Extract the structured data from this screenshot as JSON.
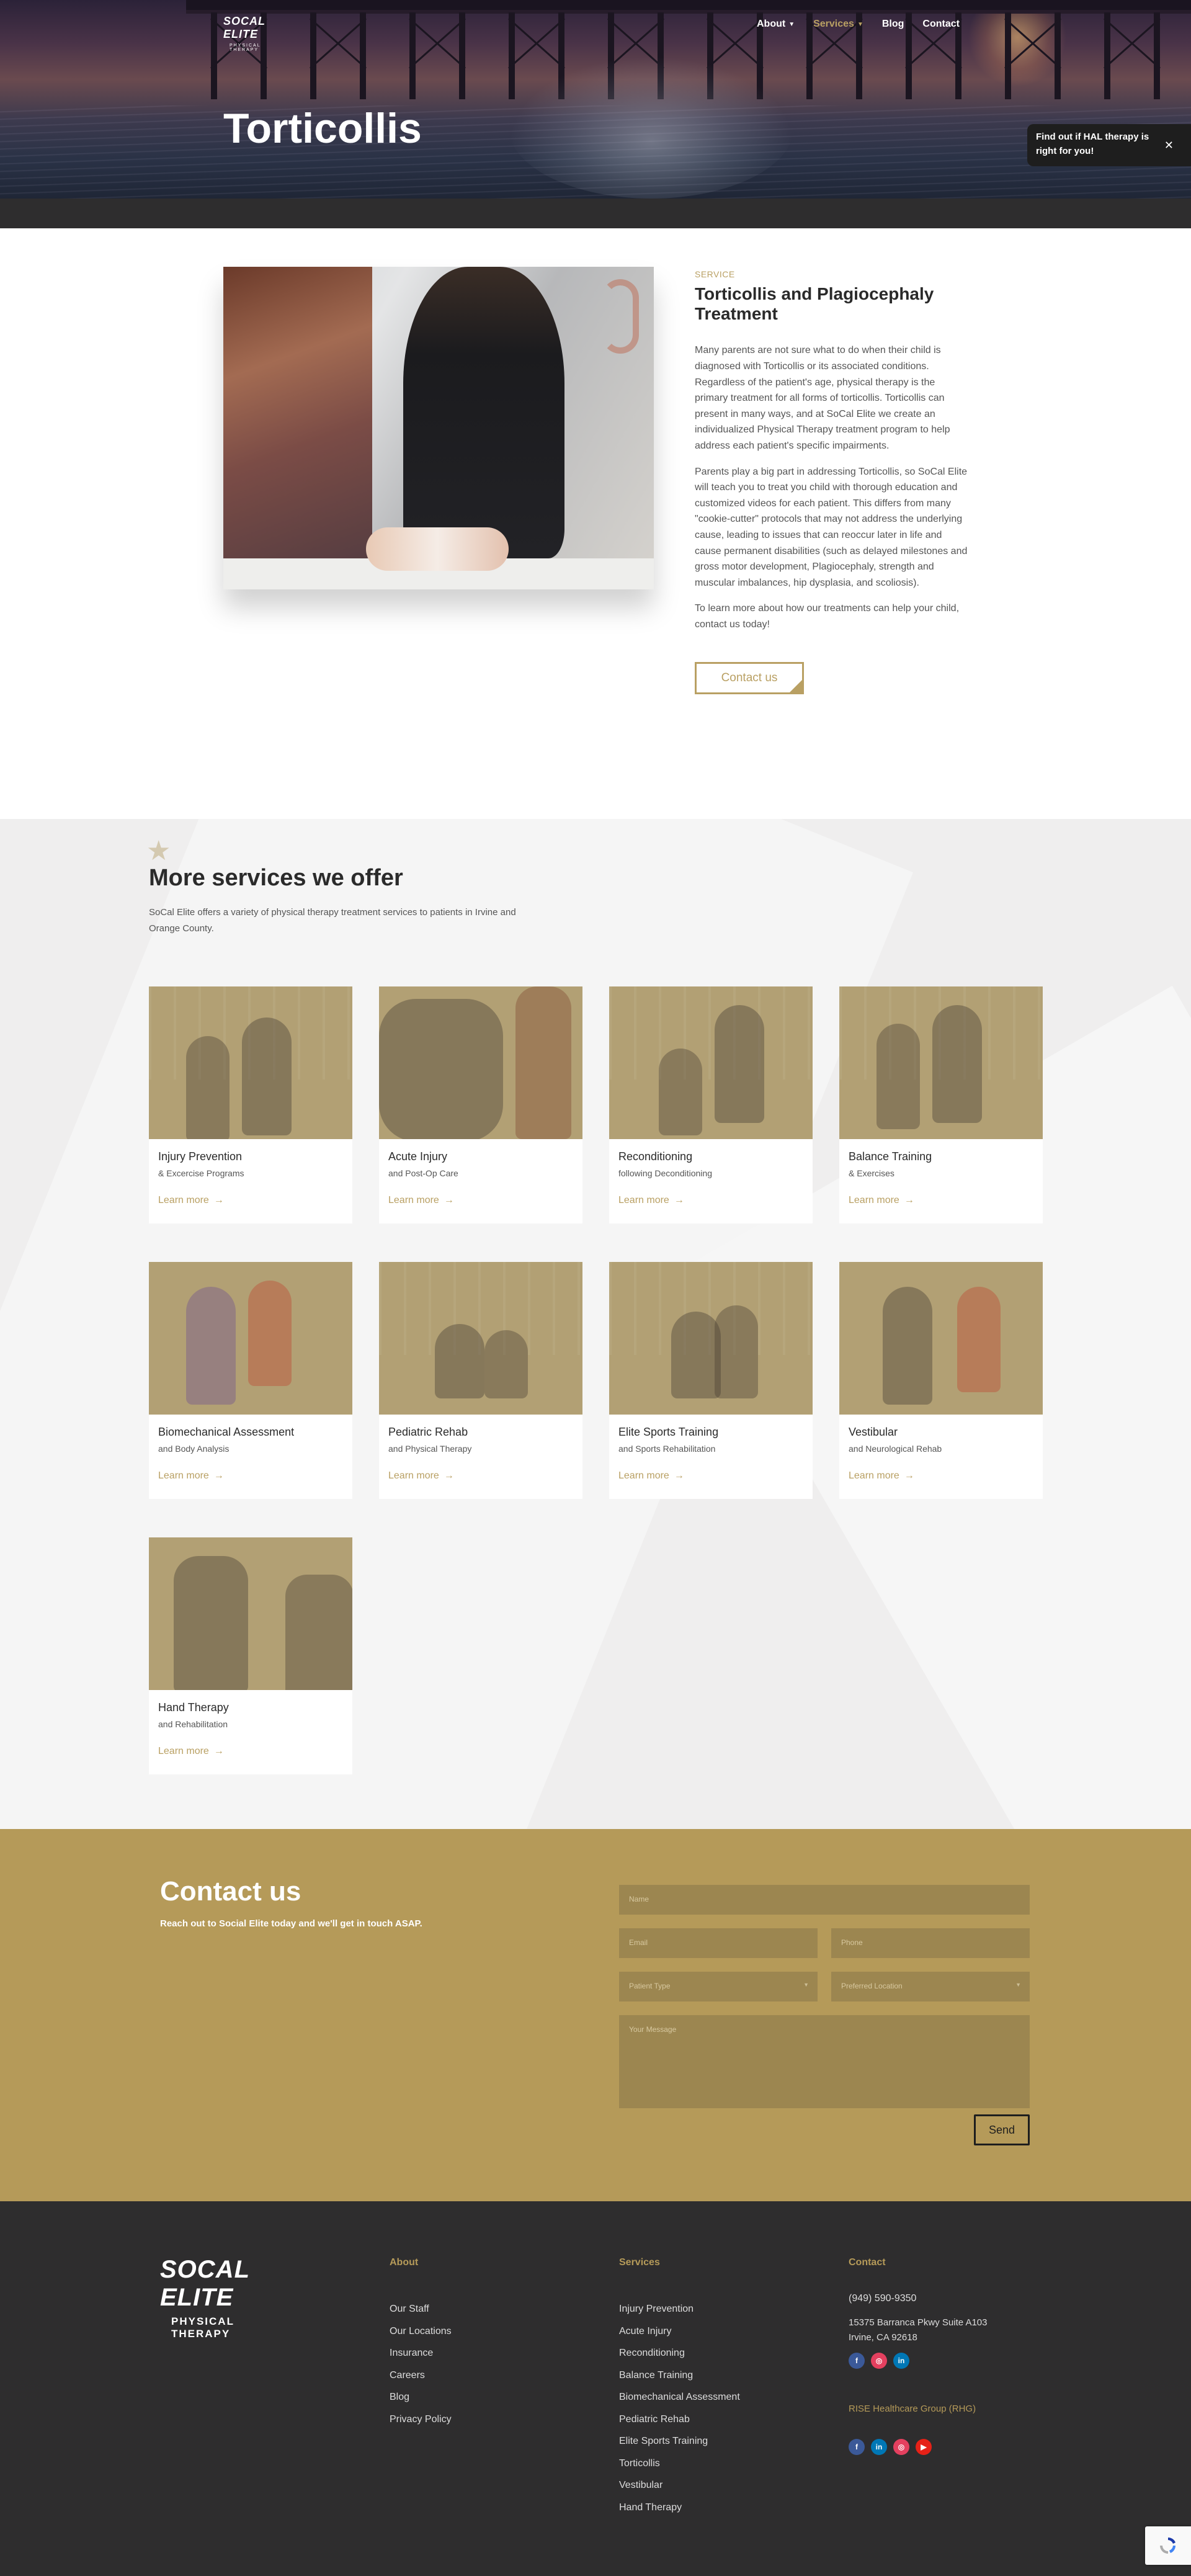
{
  "header": {
    "logo_line1": "SOCAL ELITE",
    "logo_line2": "PHYSICAL THERAPY",
    "nav": [
      {
        "label": "About",
        "chevron": true,
        "active": false
      },
      {
        "label": "Services",
        "chevron": true,
        "active": true
      },
      {
        "label": "Blog",
        "chevron": false,
        "active": false
      },
      {
        "label": "Contact",
        "chevron": false,
        "active": false
      }
    ],
    "title": "Torticollis",
    "hal_popup": "Find out if HAL therapy is right for you!",
    "hal_close_icon": "close-icon"
  },
  "service": {
    "label": "SERVICE",
    "title": "Torticollis and Plagiocephaly Treatment",
    "paragraphs": [
      "Many parents are not sure what to do when their child is diagnosed with Torticollis or its associated conditions. Regardless of the patient's age, physical therapy is the primary treatment for all forms of torticollis. Torticollis can present in many ways, and at SoCal Elite we create an individualized Physical Therapy treatment program to help address each patient's specific impairments.",
      "Parents play a big part in addressing Torticollis, so SoCal Elite will teach you to treat you child with thorough education and customized videos for each patient. This differs from many \"cookie-cutter\" protocols that may not address the underlying cause, leading to issues that can reoccur later in life and cause permanent disabilities (such as delayed milestones and gross motor development, Plagiocephaly, strength and muscular imbalances, hip dysplasia, and scoliosis).",
      "To learn more about how our treatments can help your child, contact us today!"
    ],
    "button": "Contact us"
  },
  "more_services": {
    "title": "More services we offer",
    "intro": "SoCal Elite offers a variety of physical therapy treatment services to patients in Irvine and Orange County.",
    "learn_more": "Learn more",
    "cards": [
      {
        "title": "Injury Prevention",
        "subtitle": "& Excercise Programs"
      },
      {
        "title": "Acute Injury",
        "subtitle": "and Post-Op Care"
      },
      {
        "title": "Reconditioning",
        "subtitle": "following Deconditioning"
      },
      {
        "title": "Balance Training",
        "subtitle": "& Exercises"
      },
      {
        "title": "Biomechanical Assessment",
        "subtitle": "and Body Analysis"
      },
      {
        "title": "Pediatric Rehab",
        "subtitle": "and Physical Therapy"
      },
      {
        "title": "Elite Sports Training",
        "subtitle": "and Sports Rehabilitation"
      },
      {
        "title": "Vestibular",
        "subtitle": "and Neurological Rehab"
      },
      {
        "title": "Hand Therapy",
        "subtitle": "and Rehabilitation"
      }
    ]
  },
  "contact": {
    "title": "Contact us",
    "subtitle": "Reach out to Social Elite today and we'll get in touch ASAP.",
    "fields": {
      "name": "Name",
      "email": "Email",
      "phone": "Phone",
      "patient_type": "Patient Type",
      "location": "Preferred Location",
      "message": "Your Message"
    },
    "send": "Send"
  },
  "footer": {
    "logo_line1": "SOCAL ELITE",
    "logo_line2": "PHYSICAL THERAPY",
    "about": {
      "heading": "About",
      "links": [
        "Our Staff",
        "Our Locations",
        "Insurance",
        "Careers",
        "Blog",
        "Privacy Policy"
      ]
    },
    "services": {
      "heading": "Services",
      "links": [
        "Injury Prevention",
        "Acute Injury",
        "Reconditioning",
        "Balance Training",
        "Biomechanical Assessment",
        "Pediatric Rehab",
        "Elite Sports Training",
        "Torticollis",
        "Vestibular",
        "Hand Therapy"
      ]
    },
    "contact": {
      "heading": "Contact",
      "phone": "(949) 590-9350",
      "address_line1": "15375 Barranca Pkwy Suite A103",
      "address_line2": "Irvine, CA 92618",
      "rise": "RISE Healthcare Group (RHG)"
    }
  },
  "colors": {
    "accent_gold": "#b9a063",
    "contact_bg": "#b59a59",
    "footer_bg": "#2e2d2e",
    "facebook": "#3b5998",
    "instagram": "#e4405f",
    "linkedin": "#0077b5",
    "youtube": "#e62117"
  }
}
